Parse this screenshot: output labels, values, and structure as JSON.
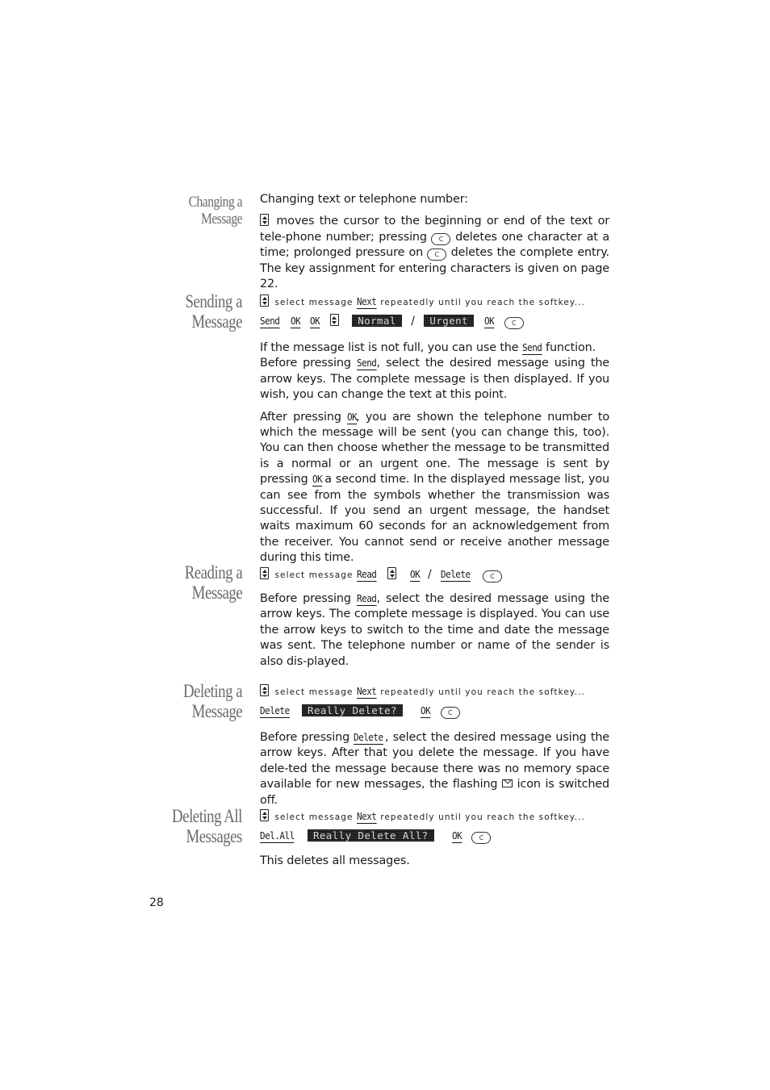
{
  "page_number": "28",
  "sections": {
    "changing": {
      "heading": [
        "Changing a",
        "Message"
      ],
      "intro": "Changing text or telephone number:",
      "para": [
        {
          "icon": "updown-arrow-key-icon"
        },
        " moves the cursor to the beginning or end of the text or tele-phone number; pressing ",
        {
          "icon": "c-key-icon",
          "label": "C"
        },
        " deletes one character at a time; prolonged pressure on ",
        {
          "icon": "c-key-icon",
          "label": "C"
        },
        " deletes the complete entry. The key assignment for entering characters is given on page 22."
      ],
      "para_text_1": " moves the cursor to the beginning or end of the text or tele-phone number; pressing ",
      "para_text_2": " deletes one character at a time; prolonged pressure on ",
      "para_text_3": " deletes the complete entry. The key assignment for entering characters is given on page 22."
    },
    "sending": {
      "heading": [
        "Sending a",
        "Message"
      ],
      "step_line": {
        "pre": "select message",
        "softkey": "Next",
        "post": "repeatedly until you reach the softkey..."
      },
      "sequence": {
        "k1": "Send",
        "k2": "OK",
        "k3": "OK",
        "d1": "Normal",
        "slash": "/",
        "d2": "Urgent",
        "k4": "OK",
        "c": "C"
      },
      "p1": {
        "a": "If the message list is not full, you can use the ",
        "key": "Send",
        "b": " function."
      },
      "p2": {
        "a": "Before pressing ",
        "key": "Send",
        "b": ", select the desired message using the arrow keys. The complete message is then displayed. If you wish, you can change the text at this point."
      },
      "p3": {
        "a": "After pressing ",
        "key": "OK",
        "b": ", you are shown the telephone number to which the message will be sent (you can change this, too). You can then choose whether the message to be transmitted is a normal or an urgent one. The message is sent by pressing ",
        "key2": "OK",
        "c": " a second time. In the displayed message list, you can see from the symbols whether the transmission was successful. If you send an urgent message, the handset waits maximum 60 seconds for an acknowledgement from the receiver. You cannot send or receive another message during this time."
      }
    },
    "reading": {
      "heading": [
        "Reading a",
        "Message"
      ],
      "step_line": {
        "pre": "select message",
        "k1": "Read",
        "k2": "OK",
        "slash": "/",
        "k3": "Delete",
        "c": "C"
      },
      "p1": {
        "a": "Before pressing ",
        "key": "Read",
        "b": ", select the desired message using the arrow keys. The complete message is displayed. You can use the arrow keys to switch to the time and date the message was sent. The telephone number or name of the sender is also dis-played."
      }
    },
    "deleting": {
      "heading": [
        "Deleting a",
        "Message"
      ],
      "step_line": {
        "pre": "select message",
        "softkey": "Next",
        "post": "repeatedly until you reach the softkey..."
      },
      "sequence": {
        "k1": "Delete",
        "d1": "Really Delete?",
        "k2": "OK",
        "c": "C"
      },
      "p1": {
        "a": "Before pressing ",
        "key": "Delete",
        "b": ", select the desired message using the arrow keys. After that you delete the message. If you have dele-ted the message because there was no memory space available for new messages, the flashing ",
        "icon": "envelope-icon",
        "c": " icon is switched off."
      }
    },
    "deleting_all": {
      "heading": [
        "Deleting All",
        "Messages"
      ],
      "step_line": {
        "pre": "select message",
        "softkey": "Next",
        "post": "repeatedly until you reach the softkey..."
      },
      "sequence": {
        "k1": "Del.All",
        "d1": "Really Delete All?",
        "k2": "OK",
        "c": "C"
      },
      "p1": "This deletes all messages."
    }
  }
}
